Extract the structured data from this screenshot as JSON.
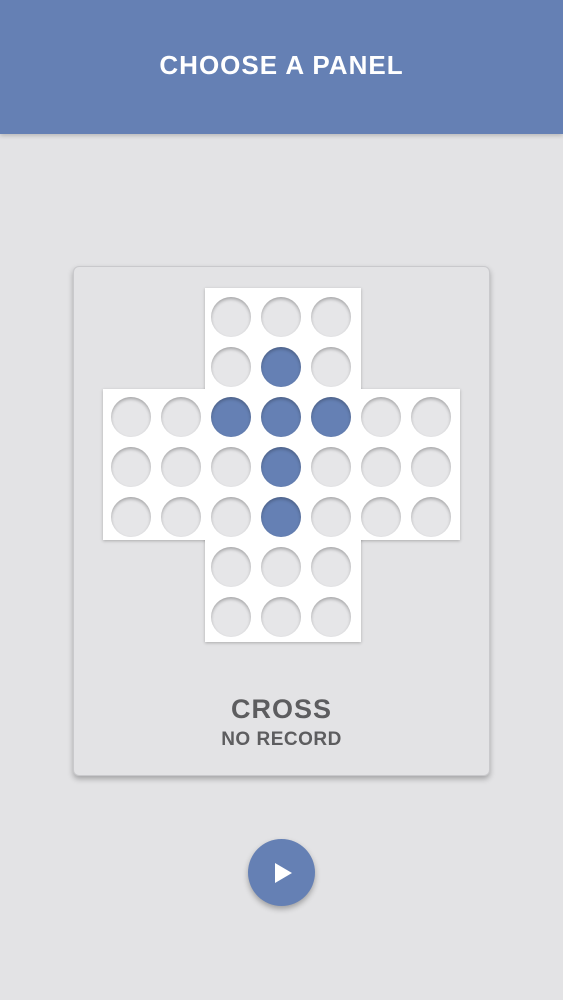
{
  "header": {
    "title": "CHOOSE A PANEL"
  },
  "panel": {
    "name": "CROSS",
    "record": "NO RECORD",
    "board": {
      "shape": "cross",
      "rows": [
        [
          null,
          null,
          0,
          0,
          0,
          null,
          null
        ],
        [
          null,
          null,
          0,
          1,
          0,
          null,
          null
        ],
        [
          0,
          0,
          1,
          1,
          1,
          0,
          0
        ],
        [
          0,
          0,
          0,
          1,
          0,
          0,
          0
        ],
        [
          0,
          0,
          0,
          1,
          0,
          0,
          0
        ],
        [
          null,
          null,
          0,
          0,
          0,
          null,
          null
        ],
        [
          null,
          null,
          0,
          0,
          0,
          null,
          null
        ]
      ],
      "legend": {
        "0": "empty-hole",
        "1": "peg"
      }
    }
  },
  "colors": {
    "accent": "#6580b4",
    "background": "#e3e3e5",
    "board": "#ffffff",
    "hole": "#e6e6e8",
    "text": "#5d5d5f"
  },
  "controls": {
    "play_icon": "play-icon"
  }
}
